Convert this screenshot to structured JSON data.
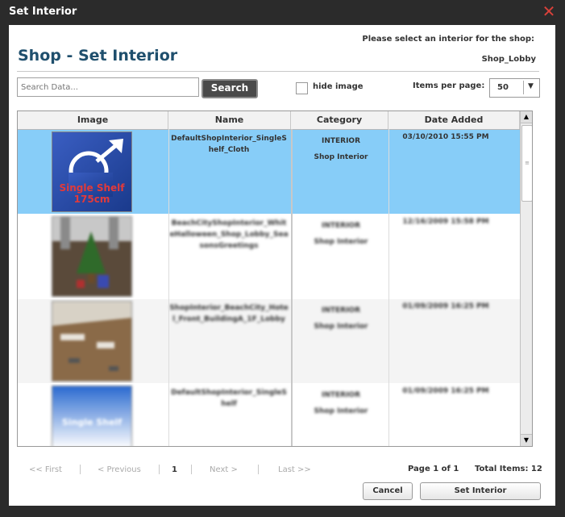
{
  "window": {
    "title": "Set Interior"
  },
  "header": {
    "heading": "Shop - Set Interior",
    "prompt": "Please select an interior for the shop:",
    "shop_name": "Shop_Lobby"
  },
  "toolbar": {
    "search_placeholder": "Search Data...",
    "search_label": "Search",
    "hide_image_label": "hide image",
    "items_per_page_label": "Items per page:",
    "items_per_page_value": "50"
  },
  "grid": {
    "columns": [
      "Image",
      "Name",
      "Category",
      "Date Added"
    ],
    "rows": [
      {
        "name": "DefaultShopInterior_SingleShelf_Cloth",
        "category": "INTERIOR",
        "subcategory": "Shop Interior",
        "date": "03/10/2010 15:55 PM",
        "thumb_text": "Single Shelf 175cm",
        "selected": true
      },
      {
        "name": "BeachCityShopInterior_WhiteHalloween_Shop_Lobby_SeasonsGreetings",
        "category": "INTERIOR",
        "subcategory": "Shop Interior",
        "date": "12/16/2009 15:58 PM"
      },
      {
        "name": "ShopInterior_BeachCity_Hotel_Front_BuildingA_1F_Lobby",
        "category": "INTERIOR",
        "subcategory": "Shop Interior",
        "date": "01/09/2009 16:25 PM"
      },
      {
        "name": "DefaultShopInterior_SingleShelf",
        "category": "INTERIOR",
        "subcategory": "Shop Interior",
        "date": "01/09/2009 16:25 PM",
        "thumb_text": "Single Shelf"
      }
    ]
  },
  "pager": {
    "first": "<< First",
    "previous": "< Previous",
    "current": "1",
    "next": "Next >",
    "last": "Last >>",
    "page_info": "Page 1 of 1",
    "total_items": "Total Items: 12"
  },
  "buttons": {
    "cancel": "Cancel",
    "set_interior": "Set Interior"
  },
  "colors": {
    "selected_row": "#87cdf8",
    "heading": "#1f4f6d",
    "close": "#d9413a"
  }
}
